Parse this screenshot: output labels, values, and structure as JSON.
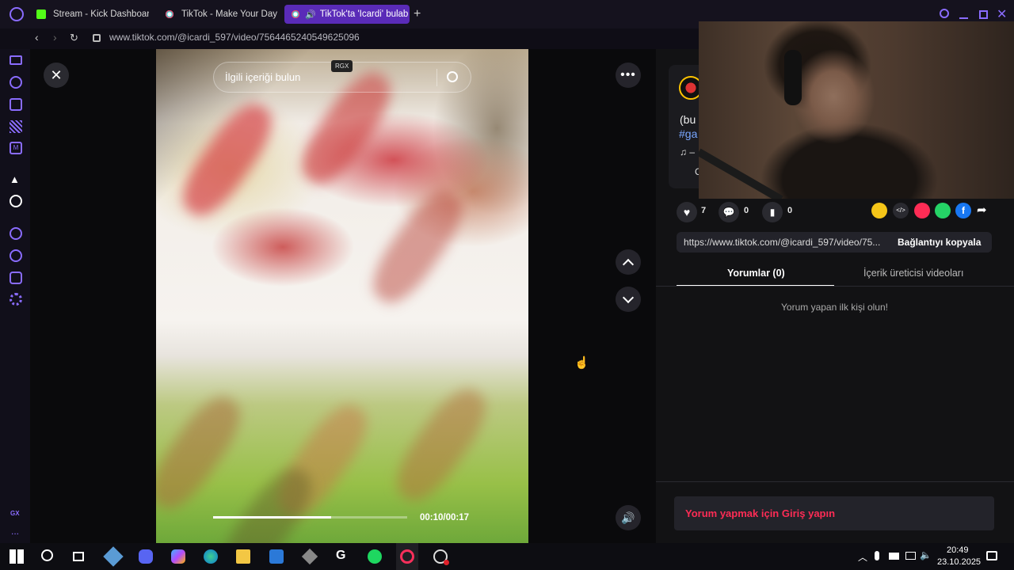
{
  "browser": {
    "tabs": [
      {
        "label": "Stream - Kick Dashboard",
        "icon": "kick-icon",
        "active": false
      },
      {
        "label": "TikTok - Make Your Day",
        "icon": "tiktok-icon",
        "active": false
      },
      {
        "label": "TikTok'ta 'Icardi' bulab",
        "icon": "tiktok-icon",
        "active": true
      }
    ],
    "url": "www.tiktok.com/@icardi_597/video/7564465240549625096",
    "new_tab": "+"
  },
  "sidebar": {
    "items": [
      "twitch-icon",
      "refresh-circle-icon",
      "store-icon",
      "wallet-icon",
      "mail-icon",
      "arc-icon",
      "openai-icon",
      "play-icon",
      "history-icon",
      "extension-icon",
      "settings-icon"
    ],
    "bottom_label": "GX",
    "more": "..."
  },
  "video": {
    "search_placeholder": "İlgili içeriği bulun",
    "rgx_label": "RGX",
    "time": "00:10/00:17",
    "progress": 0.61
  },
  "panel": {
    "caption_start": "(bu",
    "hashtag_start": "#ga",
    "music_start": "♫ –",
    "effect_start": "C",
    "likes": "7",
    "comments": "0",
    "saves": "0",
    "link": "https://www.tiktok.com/@icardi_597/video/75...",
    "copy_button": "Bağlantıyı kopyala",
    "tabs": [
      "Yorumlar (0)",
      "İçerik üreticisi videoları"
    ],
    "empty_comments": "Yorum yapan ilk kişi olun!",
    "login_prompt": "Yorum yapmak için Giriş yapın"
  },
  "taskbar": {
    "time": "20:49",
    "date": "23.10.2025"
  },
  "colors": {
    "accent": "#5a2bb8",
    "login": "#fe2c55",
    "link_blue": "#7aa7ff"
  }
}
